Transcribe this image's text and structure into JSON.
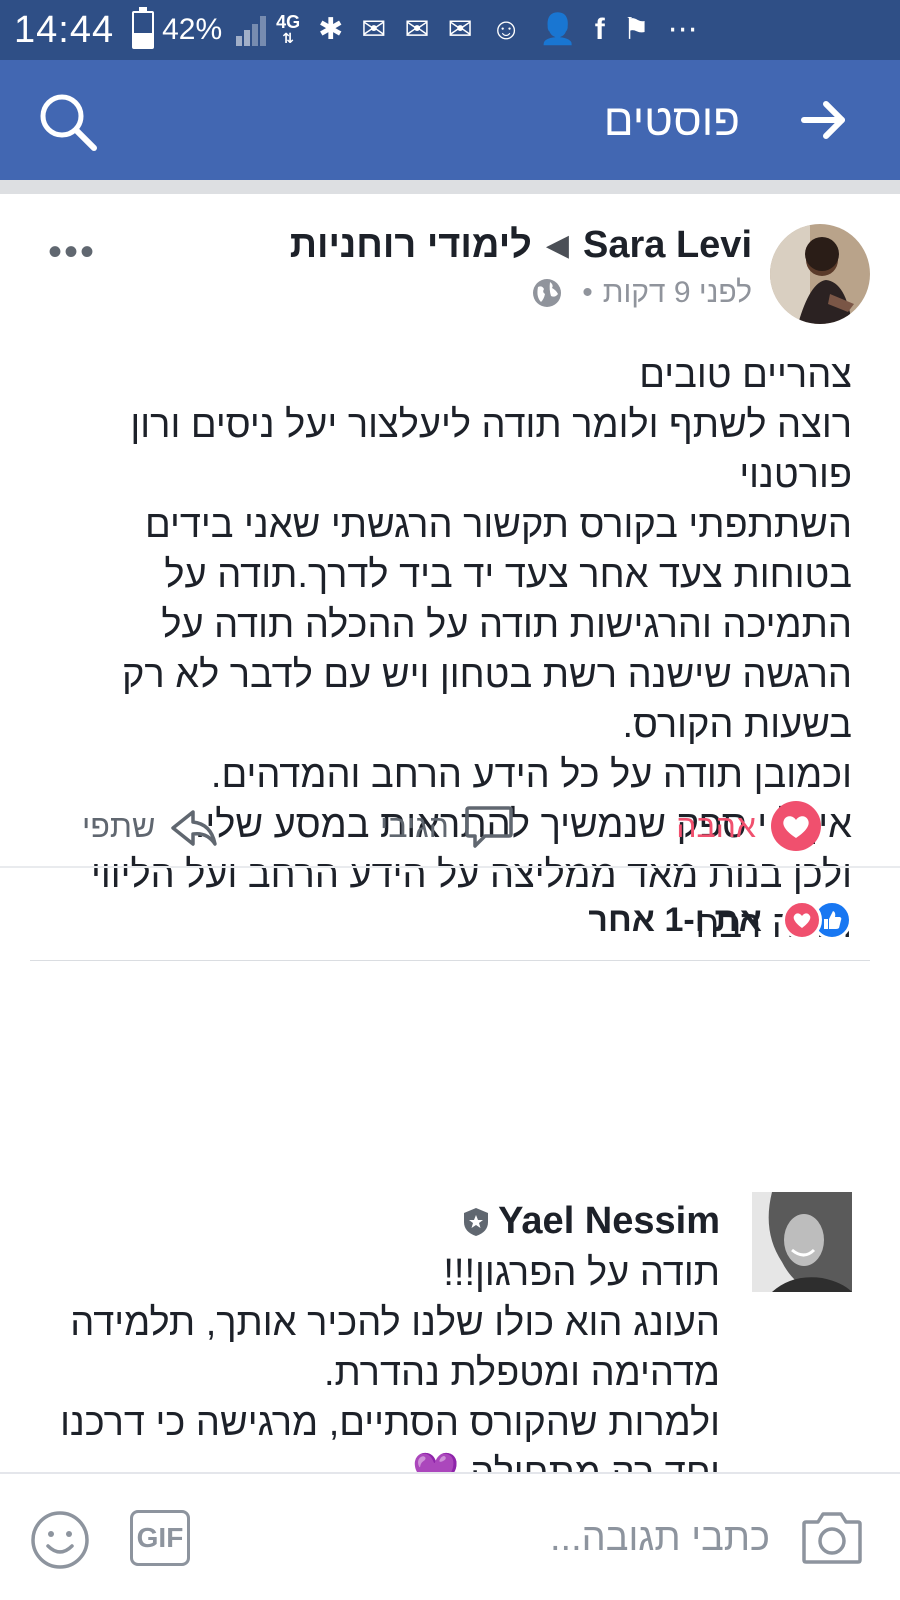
{
  "status_bar": {
    "time": "14:44",
    "battery_percent": "42%",
    "battery_level": 0.42,
    "network": "4G"
  },
  "app_bar": {
    "title": "פוסטים"
  },
  "post": {
    "author": "Sara Levi",
    "group": "לימודי רוחניות",
    "time": "לפני 9 דקות",
    "lines": [
      "צהריים טובים",
      "רוצה לשתף ולומר תודה ליעלצור יעל ניסים ורון פורטנוי",
      "השתתפתי בקורס תקשור הרגשתי שאני בידים בטוחות צעד אחר צעד יד ביד לדרך.תודה על התמיכה והרגישות תודה על ההכלה תודה על הרגשה שישנה רשת בטחון ויש עם לדבר לא רק בשעות הקורס.",
      "וכמובן תודה על כל הידע הרחב והמדהים.",
      "אין ל י ספק שנמשיך להתראות במסע שלי.",
      "ולכן בנות מאד ממליצה על הידע הרחב ועל הליווי",
      "תודה רבה"
    ],
    "actions": {
      "love": "אהבה",
      "comment": "הגיבי",
      "share": "שתפי"
    },
    "reactions_text": "את ו-1 אחר"
  },
  "comment": {
    "author": "Yael Nessim",
    "lines": [
      "תודה על הפרגון!!!",
      "העונג הוא כולו שלנו להכיר אותך, תלמידה מדהימה ומטפלת נהדרת.",
      "ולמרות שהקורס הסתיים, מרגישה כי דרכנו יחד רק מתחילה"
    ],
    "trailing_emoji": "💜"
  },
  "composer": {
    "placeholder": "כתבי תגובה...",
    "gif_label": "GIF"
  },
  "colors": {
    "status_bar": "#2f4f86",
    "app_bar": "#4267b2",
    "love": "#f0506e",
    "like": "#1877f2",
    "meta_gray": "#90949c"
  }
}
